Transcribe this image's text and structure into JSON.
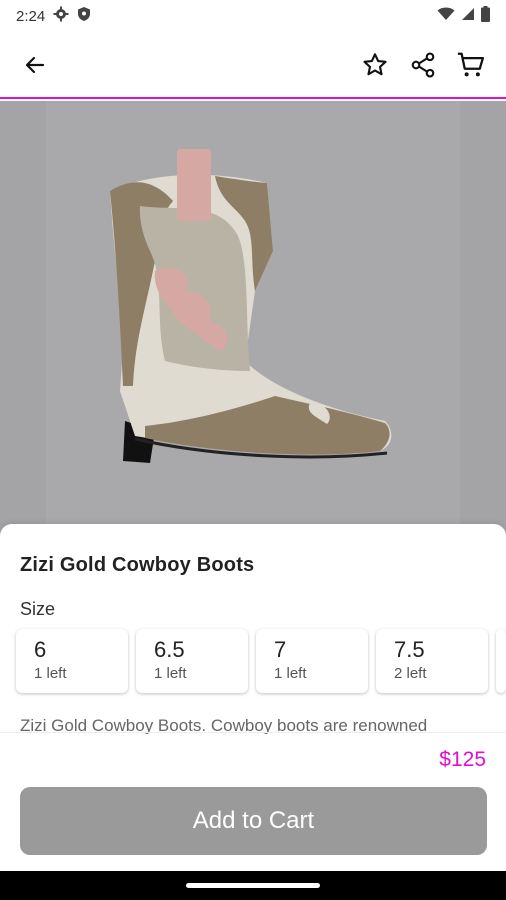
{
  "status_bar": {
    "time": "2:24",
    "icons": [
      "gear-icon",
      "shield-icon",
      "wifi-icon",
      "signal-icon",
      "battery-icon"
    ]
  },
  "app_bar": {
    "icons": [
      "back-arrow-icon",
      "star-icon",
      "share-icon",
      "cart-icon"
    ]
  },
  "product": {
    "title": "Zizi Gold Cowboy Boots",
    "size_label": "Size",
    "sizes": [
      {
        "value": "6",
        "stock": "1 left"
      },
      {
        "value": "6.5",
        "stock": "1 left"
      },
      {
        "value": "7",
        "stock": "1 left"
      },
      {
        "value": "7.5",
        "stock": "2 left"
      }
    ],
    "description": "Zizi Gold Cowboy Boots. Cowboy boots are renowned",
    "price": "$125",
    "add_to_cart_label": "Add to Cart"
  },
  "colors": {
    "accent": "#e10fcf",
    "button_disabled": "#9a9a9a",
    "hero_bg": "#a4a4a6"
  }
}
